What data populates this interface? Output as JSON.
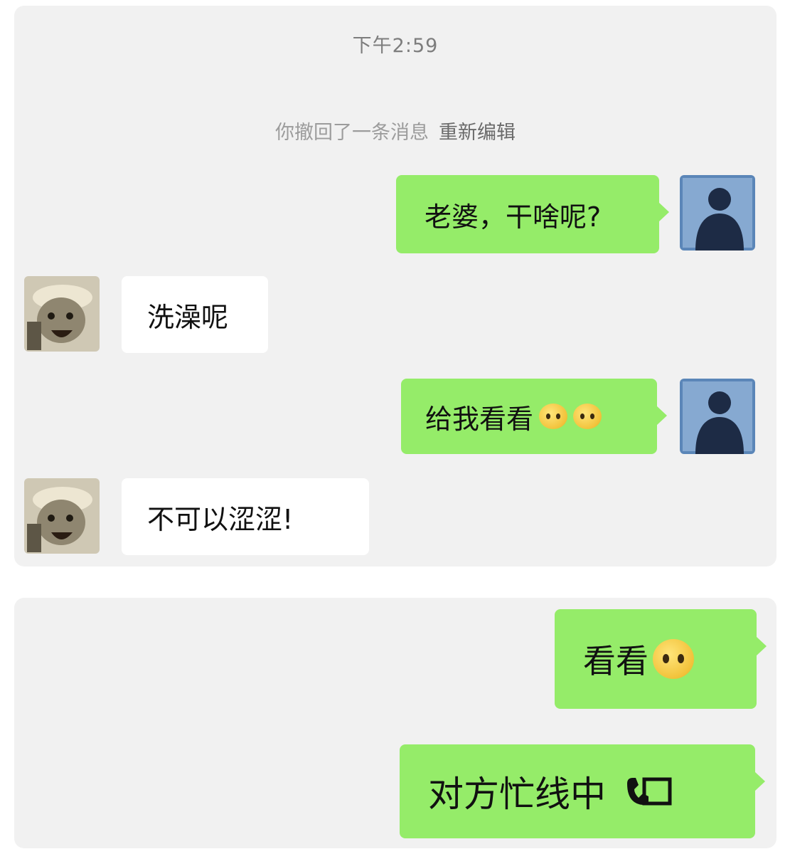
{
  "chat": {
    "timestamp": "下午2:59",
    "recall_notice": "你撤回了一条消息",
    "re_edit_label": "重新编辑",
    "messages": [
      {
        "from": "me",
        "text": "老婆，干啥呢?"
      },
      {
        "from": "other",
        "text": "洗澡呢"
      },
      {
        "from": "me",
        "text": "给我看看",
        "emoji": "peek-emoji x2"
      },
      {
        "from": "other",
        "text": "不可以涩涩!"
      },
      {
        "from": "me",
        "text": "看看",
        "emoji": "peek-emoji"
      },
      {
        "from": "me",
        "text": "对方忙线中",
        "icon": "phone-hangup-icon"
      }
    ]
  },
  "colors": {
    "sent_bubble": "#95ec69",
    "received_bubble": "#ffffff",
    "panel_background": "#f1f1f1"
  }
}
